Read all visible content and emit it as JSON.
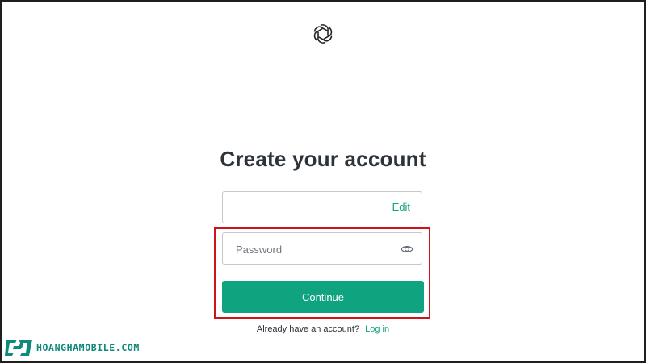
{
  "header": {
    "logo_icon": "openai-logo-icon"
  },
  "signup": {
    "title": "Create your account",
    "email_value": "",
    "edit_label": "Edit",
    "password_placeholder": "Password",
    "password_value": "",
    "password_toggle_icon": "eye-icon",
    "continue_label": "Continue",
    "login_prompt": "Already have an account?",
    "login_link": "Log in"
  },
  "watermark": {
    "text": "HOANGHAMOBILE.COM"
  },
  "colors": {
    "accent": "#10a37f",
    "text": "#2d333a",
    "border": "#c2c8d0",
    "highlight": "#d0121b",
    "watermark": "#0e8a7a"
  }
}
